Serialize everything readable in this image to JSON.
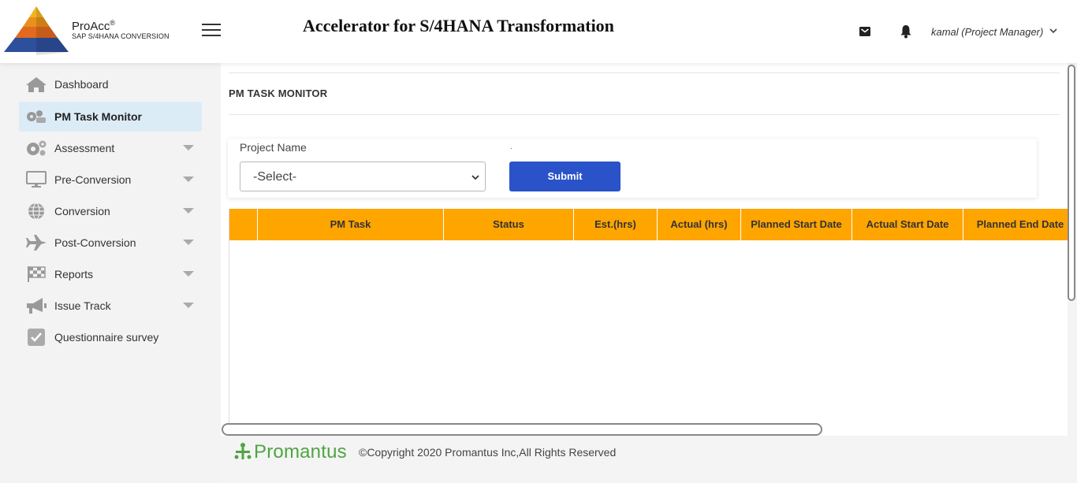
{
  "header": {
    "brand_name": "ProAcc",
    "brand_mark": "®",
    "brand_sub": "SAP S/4HANA CONVERSION",
    "title": "Accelerator for S/4HANA Transformation",
    "user_label": "kamal (Project Manager)",
    "icons": [
      "logo-pyramid",
      "menu-icon",
      "mail-icon",
      "bell-icon",
      "chevron-down-icon"
    ]
  },
  "sidebar": {
    "items": [
      {
        "label": "Dashboard",
        "icon": "home-icon",
        "active": false,
        "has_submenu": false
      },
      {
        "label": "PM Task Monitor",
        "icon": "task-monitor-icon",
        "active": true,
        "has_submenu": false
      },
      {
        "label": "Assessment",
        "icon": "gears-icon",
        "active": false,
        "has_submenu": true
      },
      {
        "label": "Pre-Conversion",
        "icon": "monitor-icon",
        "active": false,
        "has_submenu": true
      },
      {
        "label": "Conversion",
        "icon": "globe-icon",
        "active": false,
        "has_submenu": true
      },
      {
        "label": "Post-Conversion",
        "icon": "plane-icon",
        "active": false,
        "has_submenu": true
      },
      {
        "label": "Reports",
        "icon": "flag-icon",
        "active": false,
        "has_submenu": true
      },
      {
        "label": "Issue Track",
        "icon": "megaphone-icon",
        "active": false,
        "has_submenu": true
      },
      {
        "label": "Questionnaire survey",
        "icon": "checkbox-icon",
        "active": false,
        "has_submenu": false
      }
    ]
  },
  "main": {
    "page_title": "PM TASK MONITOR",
    "form": {
      "project_label": "Project Name",
      "project_value": "-Select-",
      "dot_label": ".",
      "submit_label": "Submit"
    },
    "table": {
      "columns": [
        "",
        "PM Task",
        "Status",
        "Est.(hrs)",
        "Actual (hrs)",
        "Planned Start Date",
        "Actual Start Date",
        "Planned End Date"
      ],
      "rows": []
    }
  },
  "footer": {
    "logo_text": "Promantus",
    "copyright": "©Copyright 2020 Promantus Inc,All Rights Reserved"
  },
  "colors": {
    "accent_blue": "#2a52c9",
    "table_header": "#ffa500",
    "active_nav": "#dcecf7",
    "footer_green": "#4ea542"
  }
}
